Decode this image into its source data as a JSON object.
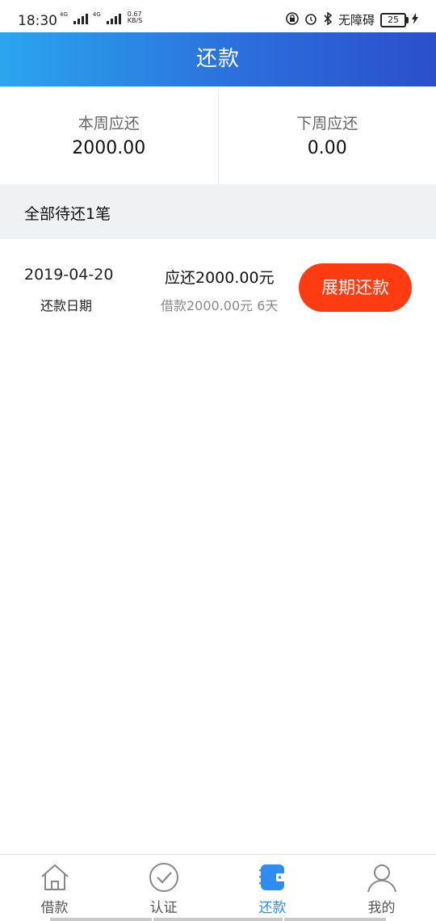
{
  "status_bar": {
    "time": "18:30",
    "network_tag_1": "4G",
    "network_tag_2": "4G",
    "speed_value": "0.67",
    "speed_unit": "KB/S",
    "accessibility_text": "无障碍",
    "battery": "25",
    "icons": [
      "lock-icon",
      "alarm-icon",
      "bluetooth-icon",
      "signal-icon",
      "battery-icon",
      "charging-icon"
    ]
  },
  "header": {
    "title": "还款"
  },
  "summary": {
    "this_week_label": "本周应还",
    "this_week_value": "2000.00",
    "next_week_label": "下周应还",
    "next_week_value": "0.00"
  },
  "section": {
    "title": "全部待还1笔"
  },
  "bill": {
    "date": "2019-04-20",
    "date_label": "还款日期",
    "due": "应还2000.00元",
    "detail": "借款2000.00元 6天",
    "button": "展期还款"
  },
  "tabs": [
    {
      "label": "借款",
      "icon": "home-icon",
      "active": false
    },
    {
      "label": "认证",
      "icon": "check-circle-icon",
      "active": false
    },
    {
      "label": "还款",
      "icon": "wallet-icon",
      "active": true
    },
    {
      "label": "我的",
      "icon": "user-icon",
      "active": false
    }
  ],
  "colors": {
    "header_gradient_start": "#2aa6ee",
    "header_gradient_end": "#2b4fca",
    "button": "#ff3b12",
    "tab_active": "#2f8cf0",
    "tab_inactive": "#888888",
    "section_bg": "#f0f1f3"
  }
}
